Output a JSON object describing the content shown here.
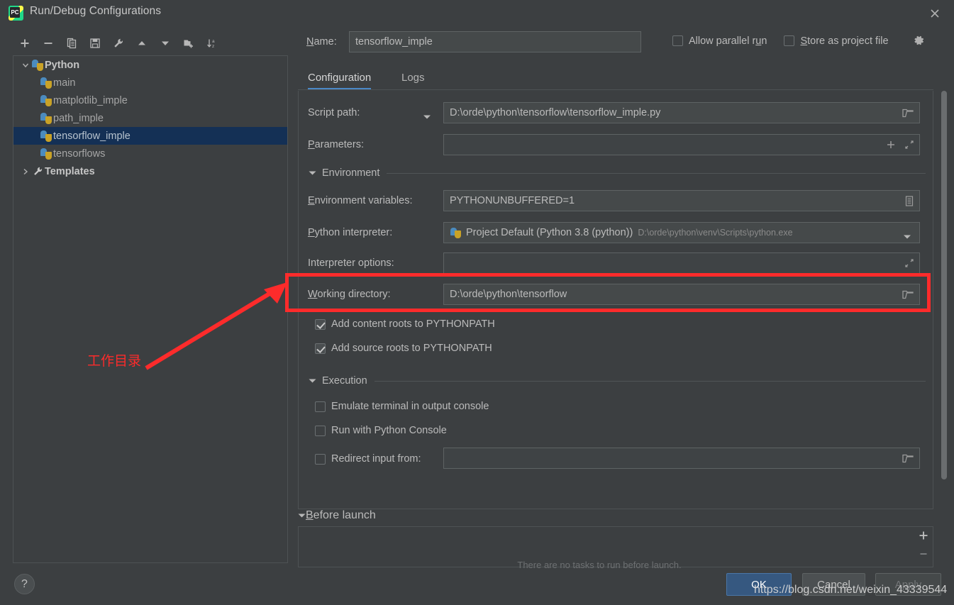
{
  "window": {
    "title": "Run/Debug Configurations",
    "logo_text": "PC",
    "close_icon": "close-icon"
  },
  "toolbar": {
    "buttons": [
      {
        "name": "add-configuration-button",
        "icon": "plus-icon"
      },
      {
        "name": "remove-configuration-button",
        "icon": "minus-icon"
      },
      {
        "name": "copy-configuration-button",
        "icon": "copy-icon"
      },
      {
        "name": "save-configuration-button",
        "icon": "save-icon"
      },
      {
        "name": "edit-templates-button",
        "icon": "wrench-icon"
      },
      {
        "name": "move-up-button",
        "icon": "arrow-up-icon"
      },
      {
        "name": "move-down-button",
        "icon": "arrow-down-icon"
      },
      {
        "name": "new-folder-button",
        "icon": "folder-add-icon"
      },
      {
        "name": "sort-alphabetically-button",
        "icon": "sort-az-icon"
      }
    ]
  },
  "tree": {
    "nodes": [
      {
        "label": "Python",
        "type": "group",
        "icon": "python-icon",
        "expanded": true,
        "selected": false
      },
      {
        "label": "main",
        "type": "child",
        "icon": "python-icon",
        "selected": false
      },
      {
        "label": "matplotlib_imple",
        "type": "child",
        "icon": "python-icon",
        "selected": false
      },
      {
        "label": "path_imple",
        "type": "child",
        "icon": "python-icon",
        "selected": false
      },
      {
        "label": "tensorflow_imple",
        "type": "child",
        "icon": "python-icon",
        "selected": true
      },
      {
        "label": "tensorflows",
        "type": "child",
        "icon": "python-icon",
        "selected": false
      },
      {
        "label": "Templates",
        "type": "group",
        "icon": "wrench-icon",
        "expanded": false,
        "selected": false
      }
    ]
  },
  "name_row": {
    "label": "Name:",
    "value": "tensorflow_imple",
    "placeholder": "",
    "allow_parallel_run": {
      "label": "Allow parallel run",
      "checked": false
    },
    "store_as_project_file": {
      "label": "Store as project file",
      "checked": false
    },
    "gear_icon": "gear-icon"
  },
  "tabs": [
    {
      "label": "Configuration",
      "active": true
    },
    {
      "label": "Logs",
      "active": false
    }
  ],
  "config": {
    "script_path": {
      "label": "Script path:",
      "value": "D:\\orde\\python\\tensorflow\\tensorflow_imple.py",
      "browse_icon": "folder-icon",
      "has_dropdown": true
    },
    "parameters": {
      "label": "Parameters:",
      "value": "",
      "placeholder": "",
      "insert_icon": "plus-icon",
      "expand_icon": "expand-icon"
    },
    "environment_section": {
      "label": "Environment",
      "expanded": true
    },
    "environment_variables": {
      "label": "Environment variables:",
      "value": "PYTHONUNBUFFERED=1",
      "browse_icon": "list-edit-icon"
    },
    "python_interpreter": {
      "label": "Python interpreter:",
      "value": "Project Default (Python 3.8 (python))",
      "detail": "D:\\orde\\python\\venv\\Scripts\\python.exe",
      "icon": "python-venv-icon",
      "dropdown_icon": "chevron-down-icon"
    },
    "interpreter_options": {
      "label": "Interpreter options:",
      "value": "",
      "expand_icon": "expand-icon"
    },
    "working_directory": {
      "label": "Working directory:",
      "value": "D:\\orde\\python\\tensorflow",
      "browse_icon": "folder-icon"
    },
    "add_content_roots": {
      "label": "Add content roots to PYTHONPATH",
      "checked": true
    },
    "add_source_roots": {
      "label": "Add source roots to PYTHONPATH",
      "checked": true
    },
    "execution_section": {
      "label": "Execution",
      "expanded": true
    },
    "emulate_terminal": {
      "label": "Emulate terminal in output console",
      "checked": false
    },
    "run_with_python_console": {
      "label": "Run with Python Console",
      "checked": false
    },
    "redirect_input": {
      "label": "Redirect input from:",
      "checked": false,
      "value": "",
      "browse_icon": "folder-icon"
    }
  },
  "before_launch": {
    "section_label": "Before launch",
    "expanded": true,
    "empty_text": "There are no tasks to run before launch.",
    "add_icon": "plus-icon",
    "remove_icon": "minus-icon"
  },
  "footer": {
    "help_label": "?",
    "ok_label": "OK",
    "cancel_label": "Cancel",
    "apply_label": "Apply",
    "apply_disabled": true
  },
  "annotations": {
    "highlight_label": "工作目录",
    "highlight_color": "#fd2b2b"
  },
  "watermark": {
    "text": "https://blog.csdn.net/weixin_43339544"
  }
}
